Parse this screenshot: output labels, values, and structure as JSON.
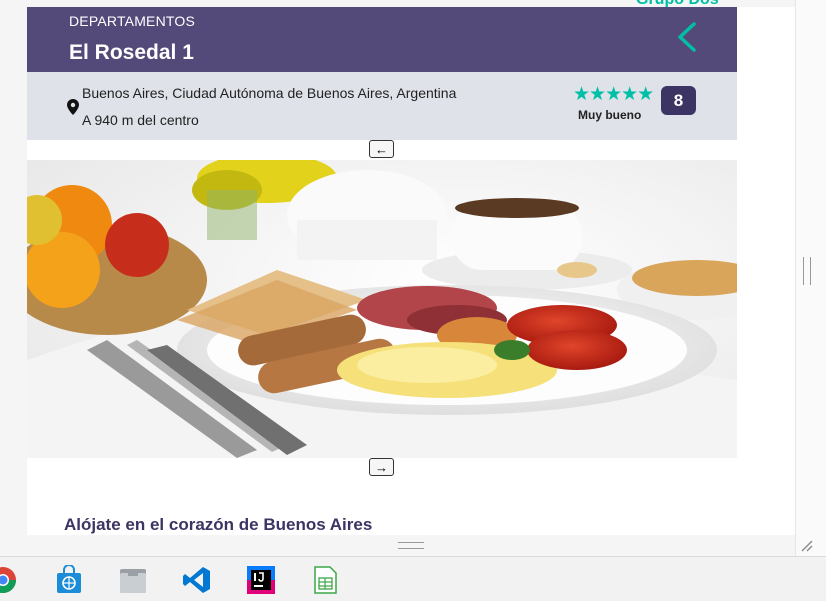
{
  "brand": {
    "name": "Grupo Dos"
  },
  "header": {
    "category": "DEPARTAMENTOS",
    "title": "El Rosedal 1"
  },
  "location": {
    "address": "Buenos Aires, Ciudad Autónoma de Buenos Aires, Argentina",
    "distance": "A 940 m del centro"
  },
  "rating": {
    "stars": "★★★★★",
    "label": "Muy bueno",
    "score": "8"
  },
  "gallery": {
    "prev_label": "←",
    "next_label": "→",
    "image_subject": "breakfast-plate"
  },
  "section": {
    "heading": "Alójate en el corazón de Buenos Aires"
  },
  "colors": {
    "header_bg": "#544a7a",
    "accent": "#00bfa5",
    "info_bg": "#dfe2e9",
    "score_bg": "#3c3563"
  },
  "taskbar": {
    "apps": [
      "chrome-icon",
      "store-icon",
      "files-icon",
      "vscode-icon",
      "intellij-icon",
      "spreadsheet-icon"
    ]
  }
}
